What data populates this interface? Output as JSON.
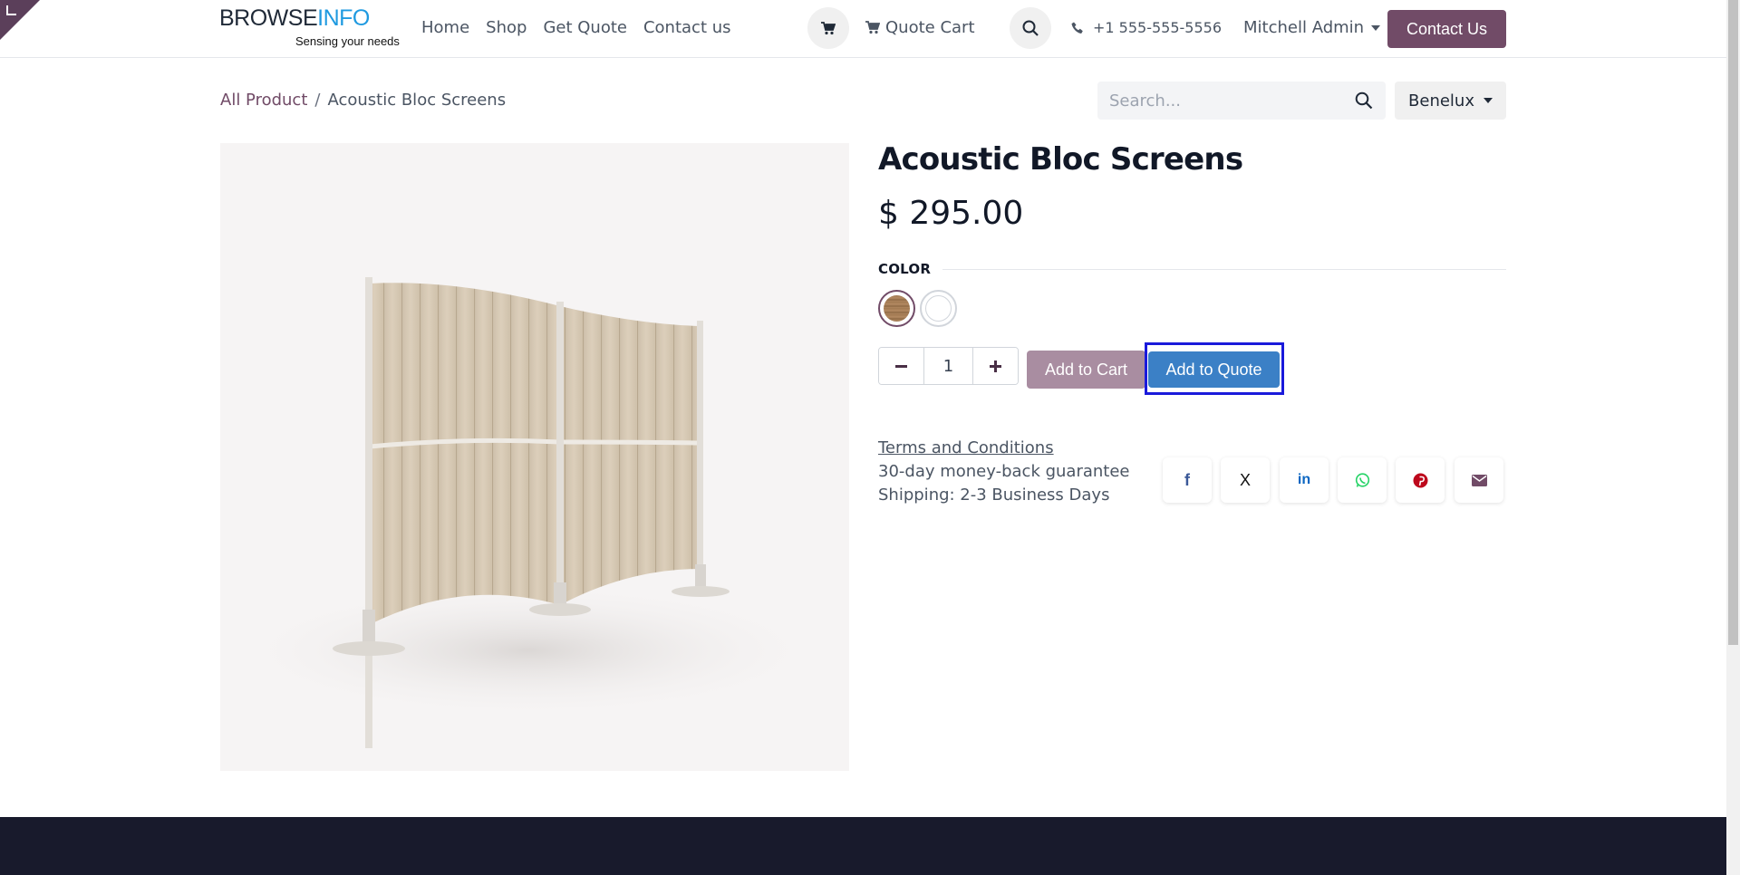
{
  "header": {
    "logo_primary": "BROWSE",
    "logo_accent": "INFO",
    "logo_tagline": "Sensing your needs",
    "nav": [
      "Home",
      "Shop",
      "Get Quote",
      "Contact us"
    ],
    "quote_cart_label": "Quote Cart",
    "phone": "+1 555-555-5556",
    "user_name": "Mitchell Admin",
    "contact_button": "Contact Us"
  },
  "breadcrumb": {
    "parent": "All Product",
    "separator": "/",
    "current": "Acoustic Bloc Screens"
  },
  "search": {
    "placeholder": "Search..."
  },
  "pricelist": {
    "selected": "Benelux"
  },
  "product": {
    "title": "Acoustic Bloc Screens",
    "price": "$ 295.00",
    "attribute_label": "COLOR",
    "colors": [
      "Wood",
      "White"
    ],
    "selected_color": "Wood",
    "quantity": "1",
    "add_to_cart": "Add to Cart",
    "add_to_quote": "Add to Quote",
    "terms": "Terms and Conditions",
    "guarantee": "30-day money-back guarantee",
    "shipping": "Shipping: 2-3 Business Days"
  },
  "share": {
    "icons": [
      "facebook-icon",
      "x-twitter-icon",
      "linkedin-icon",
      "whatsapp-icon",
      "pinterest-icon",
      "email-icon"
    ],
    "labels": [
      "f",
      "X",
      "in",
      "",
      "P",
      ""
    ]
  },
  "colors": {
    "brand": "#714b67",
    "quote_button": "#3b80c6",
    "highlight": "#1a1adb",
    "footer": "#181a2c"
  }
}
